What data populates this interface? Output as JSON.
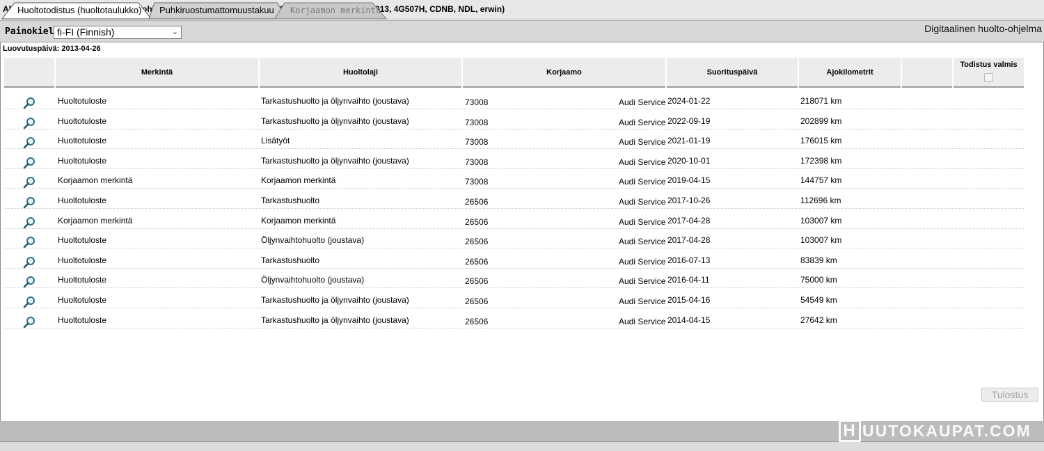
{
  "breadcrumb": "Aloitussivulle / Digitaalinen huolto-ohjelma (WAUZZZ4G5DN126045, A6 Avant 2.0 I4132 A8M, 2013, 4G507H, CDNB, NDL, erwin)",
  "language": {
    "label": "Painokieli:",
    "selected": "fi-FI (Finnish)"
  },
  "program_title": "Digitaalinen huolto-ohjelma",
  "delivery_date": "Luovutuspäivä: 2013-04-26",
  "columns": {
    "marking": "Merkintä",
    "service_type": "Huoltolaji",
    "workshop": "Korjaamo",
    "date": "Suorituspäivä",
    "km": "Ajokilometrit",
    "certificate": "Todistus valmis"
  },
  "rows": [
    {
      "marking": "Huoltotuloste",
      "service_type": "Tarkastushuolto ja öljynvaihto (joustava)",
      "workshop_no": "73008",
      "workshop": "Audi Service",
      "date": "2024-01-22",
      "km": "218071 km"
    },
    {
      "marking": "Huoltotuloste",
      "service_type": "Tarkastushuolto ja öljynvaihto (joustava)",
      "workshop_no": "73008",
      "workshop": "Audi Service",
      "date": "2022-09-19",
      "km": "202899 km"
    },
    {
      "marking": "Huoltotuloste",
      "service_type": "Lisätyöt",
      "workshop_no": "73008",
      "workshop": "Audi Service",
      "date": "2021-01-19",
      "km": "176015 km"
    },
    {
      "marking": "Huoltotuloste",
      "service_type": "Tarkastushuolto ja öljynvaihto (joustava)",
      "workshop_no": "73008",
      "workshop": "Audi Service",
      "date": "2020-10-01",
      "km": "172398 km"
    },
    {
      "marking": "Korjaamon merkintä",
      "service_type": "Korjaamon merkintä",
      "workshop_no": "73008",
      "workshop": "Audi Service",
      "date": "2019-04-15",
      "km": "144757 km"
    },
    {
      "marking": "Huoltotuloste",
      "service_type": "Tarkastushuolto",
      "workshop_no": "26506",
      "workshop": "Audi Service",
      "date": "2017-10-26",
      "km": "112696 km"
    },
    {
      "marking": "Korjaamon merkintä",
      "service_type": "Korjaamon merkintä",
      "workshop_no": "26506",
      "workshop": "Audi Service",
      "date": "2017-04-28",
      "km": "103007 km"
    },
    {
      "marking": "Huoltotuloste",
      "service_type": "Öljynvaihtohuolto (joustava)",
      "workshop_no": "26506",
      "workshop": "Audi Service",
      "date": "2017-04-28",
      "km": "103007 km"
    },
    {
      "marking": "Huoltotuloste",
      "service_type": "Tarkastushuolto",
      "workshop_no": "26506",
      "workshop": "Audi Service",
      "date": "2016-07-13",
      "km": "83839 km"
    },
    {
      "marking": "Huoltotuloste",
      "service_type": "Öljynvaihtohuolto (joustava)",
      "workshop_no": "26506",
      "workshop": "Audi Service",
      "date": "2016-04-11",
      "km": "75000 km"
    },
    {
      "marking": "Huoltotuloste",
      "service_type": "Tarkastushuolto ja öljynvaihto (joustava)",
      "workshop_no": "26506",
      "workshop": "Audi Service",
      "date": "2015-04-16",
      "km": "54549 km"
    },
    {
      "marking": "Huoltotuloste",
      "service_type": "Tarkastushuolto ja öljynvaihto (joustava)",
      "workshop_no": "26506",
      "workshop": "Audi Service",
      "date": "2014-04-15",
      "km": "27642 km"
    }
  ],
  "print_button": "Tulostus",
  "tabs": [
    {
      "label": "Huoltotodistus (huoltotaulukko)",
      "active": true
    },
    {
      "label": "Puhkiruostumattomuustakuu",
      "active": false
    },
    {
      "label": "Korjaamon merkintä",
      "active": false,
      "disabled": true
    }
  ],
  "watermark": {
    "letter": "H",
    "text": "UUTOKAUPAT.COM"
  },
  "icons": {
    "row_view": "magnifier-icon",
    "language_dropdown": "chevron-down-icon"
  }
}
